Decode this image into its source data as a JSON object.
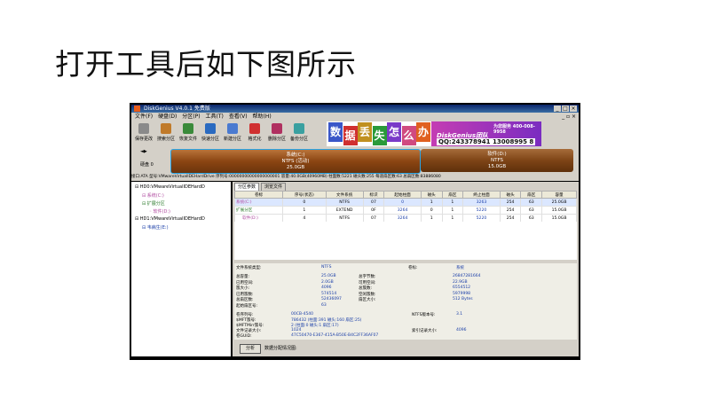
{
  "heading": "打开工具后如下图所示",
  "window": {
    "title": "DiskGenius V4.0.1 免费版",
    "controls": [
      "_",
      "□",
      "×"
    ]
  },
  "menu": [
    "文件(F)",
    "硬盘(D)",
    "分区(P)",
    "工具(T)",
    "查看(V)",
    "帮助(H)"
  ],
  "menu_right": "_ ▫ ×",
  "toolbar": [
    {
      "label": "保存更改",
      "icon": "save-icon",
      "color": "#8a8a8a"
    },
    {
      "label": "搜索分区",
      "icon": "search-icon",
      "color": "#c07a2a"
    },
    {
      "label": "恢复文件",
      "icon": "recover-icon",
      "color": "#3a8a3a"
    },
    {
      "label": "快速分区",
      "icon": "quick-partition-icon",
      "color": "#2a6ac0"
    },
    {
      "label": "新建分区",
      "icon": "new-partition-icon",
      "color": "#4a7ad0"
    },
    {
      "label": "格式化",
      "icon": "format-icon",
      "color": "#d03030"
    },
    {
      "label": "删除分区",
      "icon": "delete-icon",
      "color": "#b03060"
    },
    {
      "label": "备份分区",
      "icon": "backup-icon",
      "color": "#3aa0a0"
    }
  ],
  "banner": {
    "tiles": [
      {
        "text": "数",
        "color": "#3a56c8"
      },
      {
        "text": "据",
        "color": "#d03030"
      },
      {
        "text": "丢",
        "color": "#c09020"
      },
      {
        "text": "失",
        "color": "#2a9a3a"
      },
      {
        "text": "怎",
        "color": "#7a3ac8"
      },
      {
        "text": "么",
        "color": "#d04a80"
      },
      {
        "text": "办",
        "color": "#e06020"
      }
    ],
    "brand": "DiskGenius团队",
    "slogan": "为您服务 400-008-9958",
    "phone": "QQ:243378941 13008995 8"
  },
  "disk": {
    "label": "硬盘 0",
    "partitions": [
      {
        "name": "系统(C:)",
        "fs": "NTFS (活动)",
        "size": "25.0GB"
      },
      {
        "name": "软件(D:)",
        "fs": "NTFS",
        "size": "15.0GB"
      }
    ]
  },
  "infoline": "接口:ATA  型号:VMwareVirtualIDEHardDrive  序列号:00000000000000000001  容量:40.0GB(40960MB)  柱面数:5221  磁头数:255  每道扇区数:63  总扇区数:83886080",
  "tree": [
    {
      "text": "HD0:VMwareVirtualIDEHardD",
      "indent": 0,
      "color": "#000"
    },
    {
      "text": "系统(C:)",
      "indent": 1,
      "color": "#b04aa0"
    },
    {
      "text": "扩展分区",
      "indent": 1,
      "color": "#2a7a2a"
    },
    {
      "text": "软件(D:)",
      "indent": 2,
      "color": "#b04aa0"
    },
    {
      "text": "HD1:VMwareVirtualIDEHardD",
      "indent": 0,
      "color": "#000"
    },
    {
      "text": "韦病生(E:)",
      "indent": 1,
      "color": "#1a3ea8"
    }
  ],
  "tabs": [
    "分区参数",
    "浏览文件"
  ],
  "table": {
    "headers": [
      "卷标",
      "序号(状态)",
      "文件系统",
      "标识",
      "起始柱面",
      "磁头",
      "扇区",
      "终止柱面",
      "磁头",
      "扇区",
      "容量"
    ],
    "rows": [
      [
        "系统(C:)",
        "0",
        "NTFS",
        "07",
        "0",
        "1",
        "1",
        "3263",
        "254",
        "63",
        "25.0GB"
      ],
      [
        "扩展分区",
        "1",
        "EXTEND",
        "0F",
        "3264",
        "0",
        "1",
        "5220",
        "254",
        "63",
        "15.0GB"
      ],
      [
        "软件(D:)",
        "4",
        "NTFS",
        "07",
        "3264",
        "1",
        "1",
        "5220",
        "254",
        "63",
        "15.0GB"
      ]
    ]
  },
  "details": {
    "fs_type_label": "文件系统类型:",
    "fs_type": "NTFS",
    "vol_label_label": "卷标:",
    "vol_label": "系统",
    "left": [
      {
        "k": "总容量:",
        "v": "25.0GB"
      },
      {
        "k": "已用空间:",
        "v": "2.0GB"
      },
      {
        "k": "簇大小:",
        "v": "4096"
      },
      {
        "k": "已用簇数:",
        "v": "574514"
      },
      {
        "k": "总扇区数:",
        "v": "52436097"
      },
      {
        "k": "起始扇区号:",
        "v": "63"
      }
    ],
    "right": [
      {
        "k": "总字节数:",
        "v": "26847281664"
      },
      {
        "k": "可用空间:",
        "v": "22.9GB"
      },
      {
        "k": "总簇数:",
        "v": "6554512"
      },
      {
        "k": "空闲簇数:",
        "v": "5979998"
      },
      {
        "k": "扇区大小:",
        "v": "512 Bytes"
      },
      {
        "k": "",
        "v": ""
      }
    ],
    "left2": [
      {
        "k": "卷序列号:",
        "v": "00CB-4540"
      },
      {
        "k": "$MFT簇号:",
        "v": "786432 (柱面:391 磁头:160 扇区:25)"
      },
      {
        "k": "$MFTMirr簇号:",
        "v": "2 (柱面:0 磁头:1 扇区:17)"
      },
      {
        "k": "文件记录大小:",
        "v": "1024"
      },
      {
        "k": "卷GUID:",
        "v": "47C50470-E367-415A-B50E-B4C2FF36AF07"
      }
    ],
    "right2": [
      {
        "k": "NTFS版本号:",
        "v": "3.1"
      },
      {
        "k": "",
        "v": ""
      },
      {
        "k": "",
        "v": ""
      },
      {
        "k": "索引记录大小:",
        "v": "4096"
      },
      {
        "k": "",
        "v": ""
      }
    ]
  },
  "bottom": {
    "button": "分析",
    "label": "数据分配情况图:"
  }
}
